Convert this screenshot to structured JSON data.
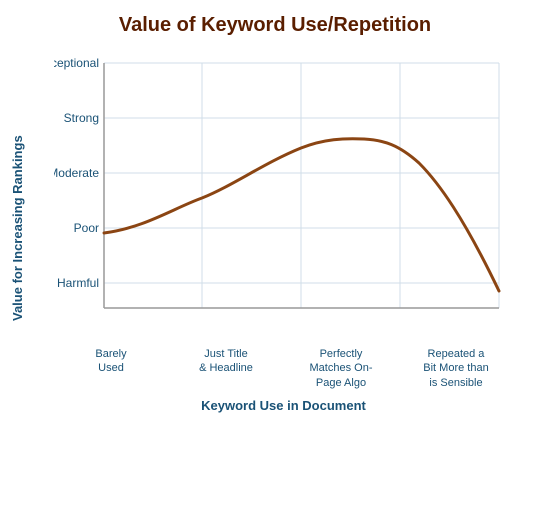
{
  "title": "Value of Keyword Use/Repetition",
  "y_axis_label": "Value for Increasing Rankings",
  "x_axis_label": "Keyword Use in Document",
  "y_ticks": [
    "Exceptional",
    "Strong",
    "Moderate",
    "Poor",
    "Harmful"
  ],
  "x_labels": [
    {
      "line1": "Barely",
      "line2": "Used"
    },
    {
      "line1": "Just Title",
      "line2": "& Headline"
    },
    {
      "line1": "Perfectly",
      "line2": "Matches On-",
      "line3": "Page Algo"
    },
    {
      "line1": "Repeated a",
      "line2": "Bit More than",
      "line3": "is Sensible"
    }
  ],
  "colors": {
    "title": "#5a1e00",
    "axis_label": "#1a5276",
    "curve": "#8b4513",
    "grid": "#d0dde8",
    "axis_line": "#888"
  }
}
